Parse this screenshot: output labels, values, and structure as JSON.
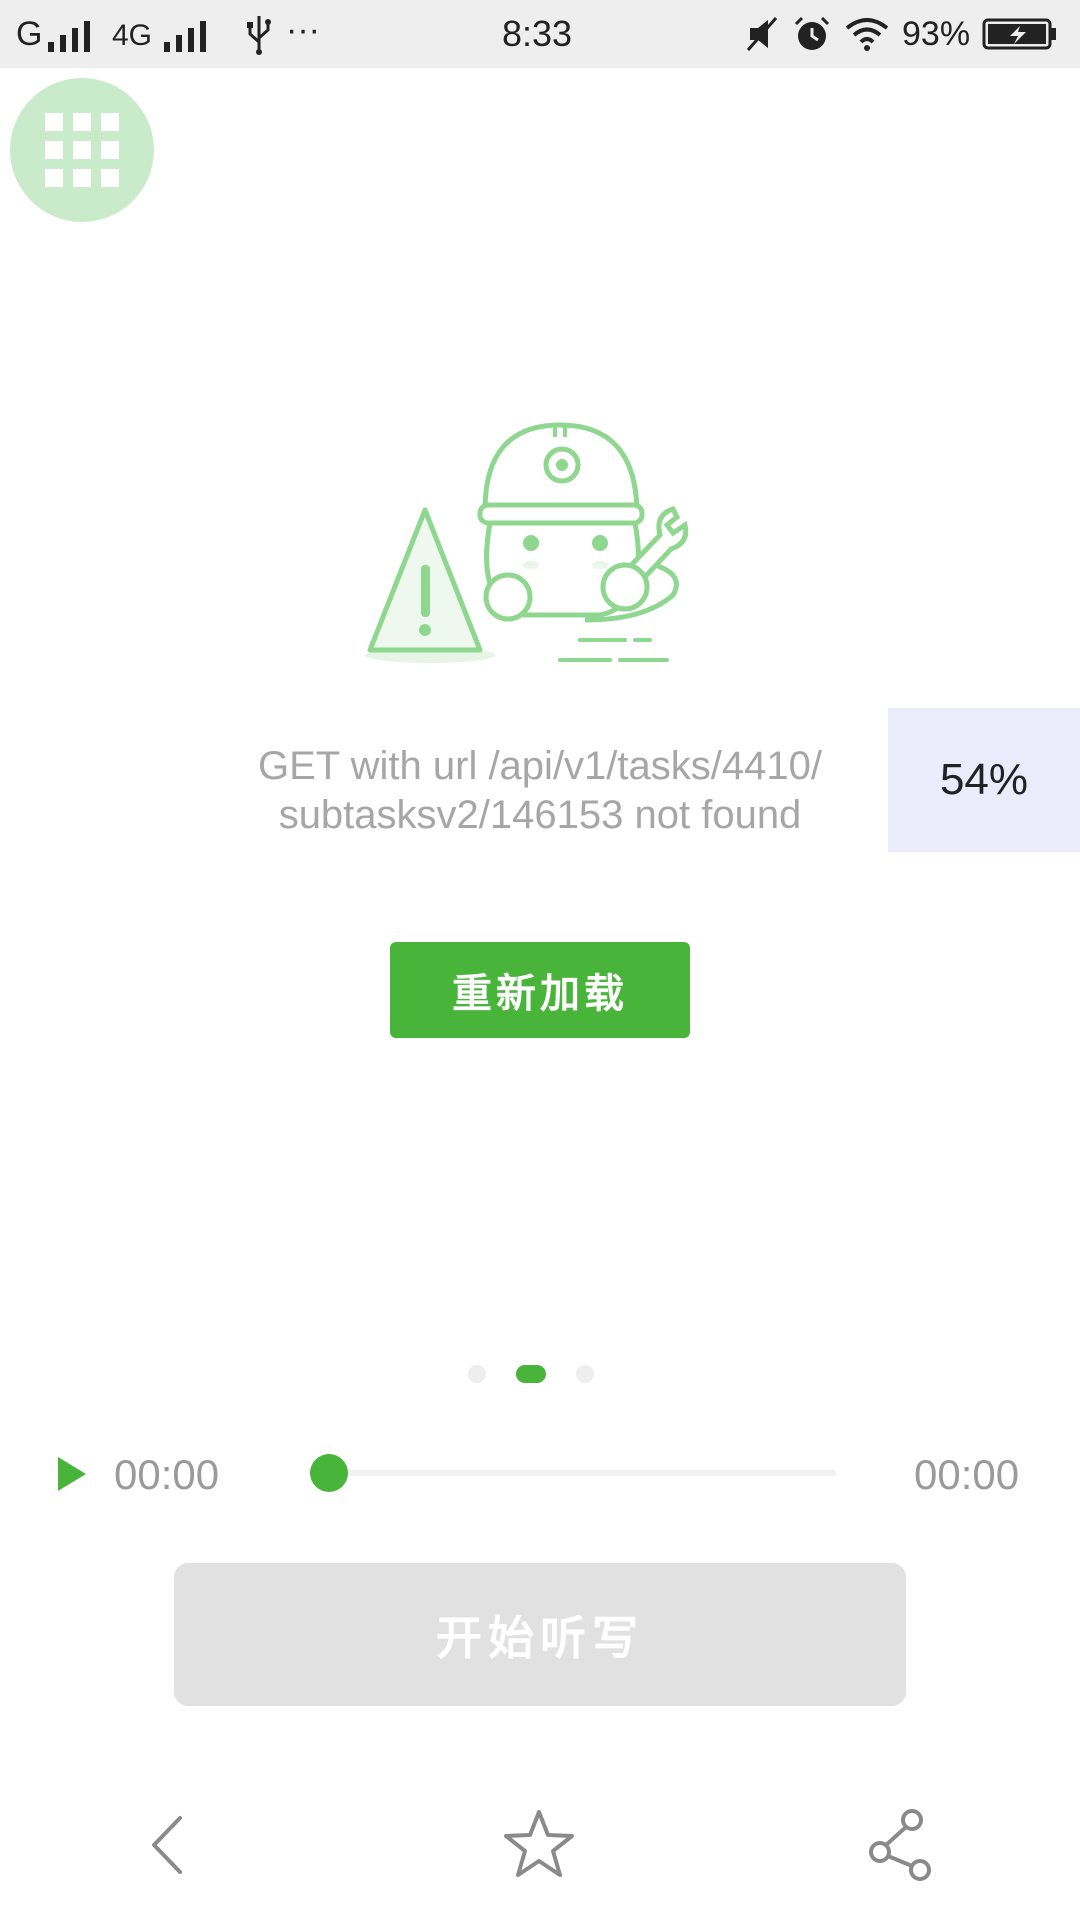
{
  "status_bar": {
    "carrier_left": "G",
    "network_type": "4G",
    "overflow": "···",
    "time": "8:33",
    "battery_percent": "93%",
    "icons": [
      "signal-icon",
      "usb-icon",
      "mute-icon",
      "alarm-icon",
      "wifi-icon",
      "battery-charging-icon"
    ]
  },
  "menu_button": {
    "icon": "grid-icon",
    "color": "#c9ebc9"
  },
  "error": {
    "illustration": "robot-repair-warning-illustration",
    "message_line1": "GET with url /api/v1/tasks/4410/",
    "message_line2": "subtasksv2/146153 not found"
  },
  "percent_badge": {
    "label": "54%"
  },
  "reload_button": {
    "label": "重新加载",
    "color": "#48b43a"
  },
  "pager": {
    "count": 3,
    "active_index": 1
  },
  "player": {
    "current_time": "00:00",
    "total_time": "00:00",
    "progress": 0,
    "play_icon": "play-icon"
  },
  "start_button": {
    "label": "开始听写",
    "enabled": false
  },
  "bottom_nav": {
    "icons": [
      "back-icon",
      "star-icon",
      "share-icon"
    ]
  },
  "colors": {
    "accent": "#48b43a",
    "muted_text": "#a6a6a6"
  }
}
